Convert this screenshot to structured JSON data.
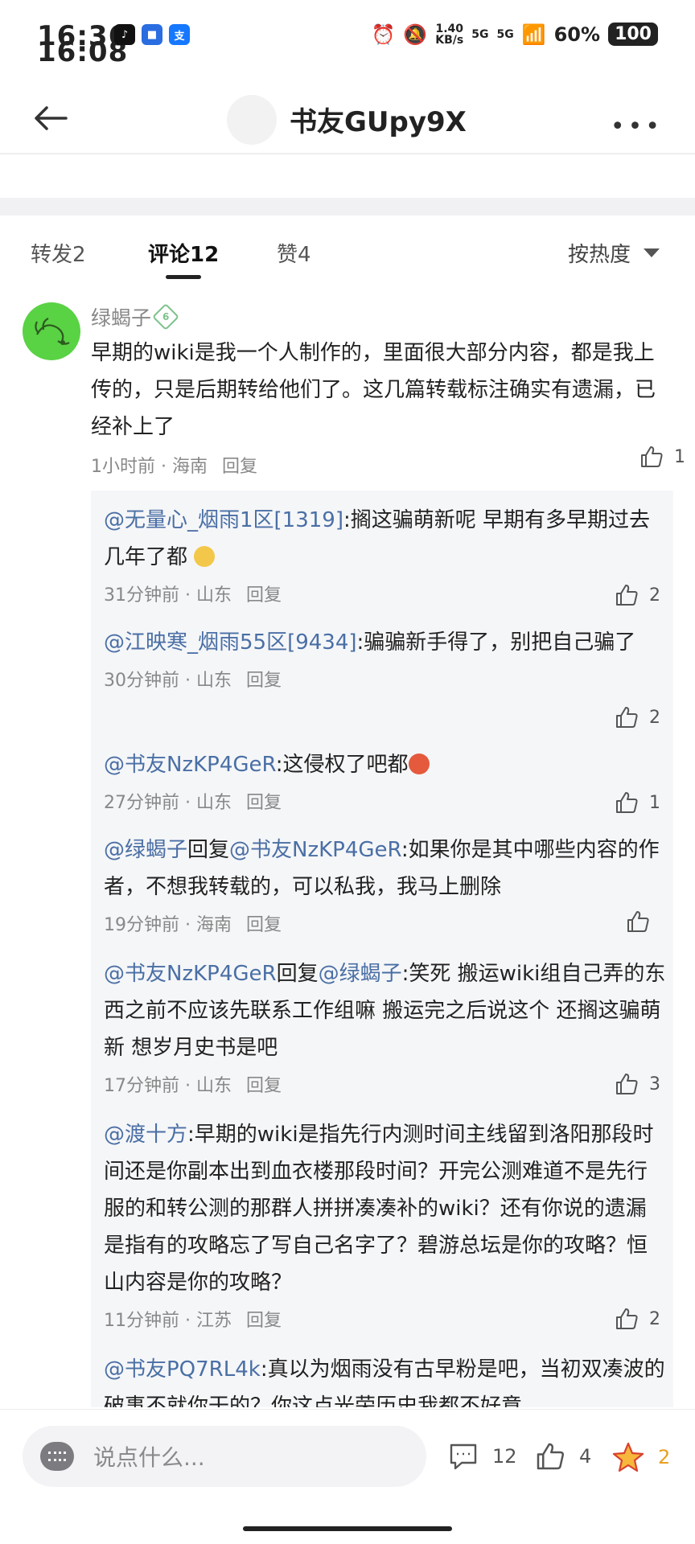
{
  "status_bar": {
    "time_line1": "16:36",
    "time_line2": "16:08",
    "net_speed_value": "1.40",
    "net_speed_unit": "KB/s",
    "signal_label": "5G",
    "signal_label_2": "5G",
    "percent": "60%",
    "battery": "100"
  },
  "header": {
    "title": "书友GUpy9X"
  },
  "tabs": [
    {
      "label": "转发2"
    },
    {
      "label": "评论12"
    },
    {
      "label": "赞4"
    }
  ],
  "sort": {
    "label": "按热度"
  },
  "comment": {
    "author": "绿蝎子",
    "level": "6",
    "text": "早期的wiki是我一个人制作的，里面很大部分内容，都是我上传的，只是后期转给他们了。这几篇转载标注确实有遗漏，已经补上了",
    "time": "1小时前",
    "location": "海南",
    "reply_label": "回复",
    "likes": "1"
  },
  "replies": [
    {
      "at": "@无量心_烟雨1区[1319]",
      "text": ":搁这骗萌新呢 早期有多早期过去几年了都",
      "emoji_color": "#f3c74a",
      "time": "31分钟前",
      "location": "山东",
      "reply_label": "回复",
      "likes": "2"
    },
    {
      "at": "@江映寒_烟雨55区[9434]",
      "text": ":骗骗新手得了，别把自己骗了",
      "time": "30分钟前",
      "location": "山东",
      "reply_label": "回复",
      "likes": "2"
    },
    {
      "at": "@书友NzKP4GeR",
      "text": ":这侵权了吧都",
      "emoji_color": "#e55a3c",
      "time": "27分钟前",
      "location": "山东",
      "reply_label": "回复",
      "likes": "1"
    },
    {
      "at": "@绿蝎子",
      "mid": "回复",
      "at2": "@书友NzKP4GeR",
      "text": ":如果你是其中哪些内容的作者，不想我转载的，可以私我，我马上删除",
      "time": "19分钟前",
      "location": "海南",
      "reply_label": "回复",
      "likes": ""
    },
    {
      "at": "@书友NzKP4GeR",
      "mid": "回复",
      "at2": "@绿蝎子",
      "text": ":笑死  搬运wiki组自己弄的东西之前不应该先联系工作组嘛  搬运完之后说这个  还搁这骗萌新  想岁月史书是吧",
      "time": "17分钟前",
      "location": "山东",
      "reply_label": "回复",
      "likes": "3"
    },
    {
      "at": "@渡十方",
      "text": ":早期的wiki是指先行内测时间主线留到洛阳那段时间还是你副本出到血衣楼那段时间？开完公测难道不是先行服的和转公测的那群人拼拼凑凑补的wiki？还有你说的遗漏是指有的攻略忘了写自己名字了？碧游总坛是你的攻略？恒山内容是你的攻略？",
      "time": "11分钟前",
      "location": "江苏",
      "reply_label": "回复",
      "likes": "2"
    },
    {
      "at": "@书友PQ7RL4k",
      "text": ":真以为烟雨没有古早粉是吧，当初双凑波的破事不就你干的？你这点光荣历史我都不好意",
      "time": "",
      "location": "",
      "reply_label": "",
      "likes": ""
    }
  ],
  "bottom_bar": {
    "placeholder": "说点什么...",
    "comments": "12",
    "likes": "4",
    "favorites": "2"
  },
  "colors": {
    "link": "#4a6fa5",
    "avatar_green": "#59d244",
    "star": "#e7a020"
  }
}
